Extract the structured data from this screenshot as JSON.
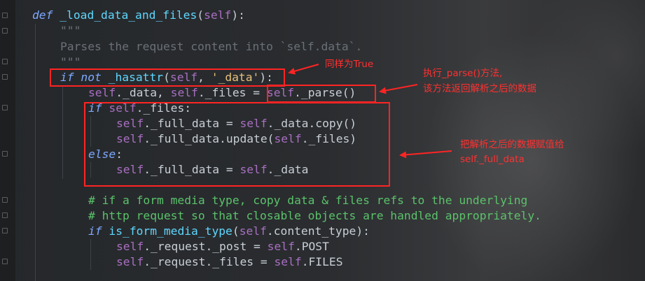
{
  "code": {
    "def_kw": "def",
    "func_name": "_load_data_and_files",
    "param_self": "self",
    "doc_open": "\"\"\"",
    "doc_text": "Parses the request content into `self.data`.",
    "doc_close": "\"\"\"",
    "if_kw": "if",
    "not_kw": "not",
    "hasattr_call": "_hasattr",
    "data_str": "'_data'",
    "assign_data": "._data, ",
    "assign_files": "._files = ",
    "parse_call": "._parse()",
    "files_attr": "._files:",
    "full_data": "._full_data = ",
    "data_copy": "._data.copy()",
    "full_data_update": "._full_data.update(",
    "files_close": "._files)",
    "else_kw": "else",
    "data_attr": "._data",
    "comment1": "# if a form media type, copy data & files refs to the underlying",
    "comment2": "# http request so that closable objects are handled appropriately.",
    "is_form_call": "is_form_media_type",
    "content_type": ".content_type):",
    "request_post": "._request._post = ",
    "post_attr": ".POST",
    "request_files": "._request._files = ",
    "files_upper": ".FILES"
  },
  "annotations": {
    "note1": "同样为True",
    "note2_line1": "执行_parse()方法,",
    "note2_line2": "该方法返回解析之后的数据",
    "note3_line1": "把解析之后的数据赋值给",
    "note3_line2": "self._full_data"
  },
  "colors": {
    "annotation_red": "#ff2424",
    "keyword": "#7da9ff",
    "self": "#a86fc1",
    "comment": "#5bc26b",
    "function": "#5fd7ff"
  }
}
